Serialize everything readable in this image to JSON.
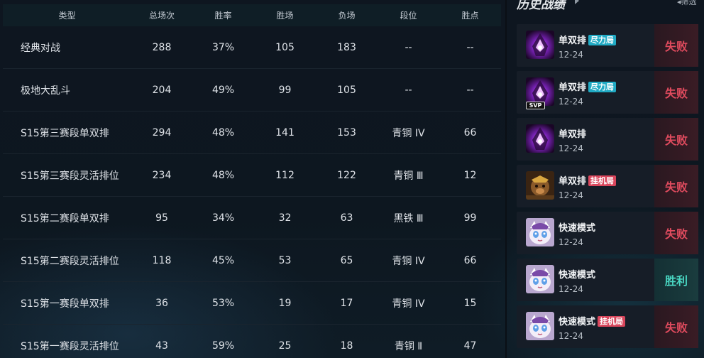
{
  "table": {
    "headers": [
      "类型",
      "总场次",
      "胜率",
      "胜场",
      "负场",
      "段位",
      "胜点"
    ],
    "rows": [
      [
        "经典对战",
        "288",
        "37%",
        "105",
        "183",
        "--",
        "--"
      ],
      [
        "极地大乱斗",
        "204",
        "49%",
        "99",
        "105",
        "--",
        "--"
      ],
      [
        "S15第三赛段单双排",
        "294",
        "48%",
        "141",
        "153",
        "青铜 IV",
        "66"
      ],
      [
        "S15第三赛段灵活排位",
        "234",
        "48%",
        "112",
        "122",
        "青铜 Ⅲ",
        "12"
      ],
      [
        "S15第二赛段单双排",
        "95",
        "34%",
        "32",
        "63",
        "黑铁 Ⅲ",
        "99"
      ],
      [
        "S15第二赛段灵活排位",
        "118",
        "45%",
        "53",
        "65",
        "青铜 IV",
        "66"
      ],
      [
        "S15第一赛段单双排",
        "36",
        "53%",
        "19",
        "17",
        "青铜 IV",
        "15"
      ],
      [
        "S15第一赛段灵活排位",
        "43",
        "59%",
        "25",
        "18",
        "青铜 Ⅱ",
        "47"
      ]
    ]
  },
  "history": {
    "title": "历史战绩",
    "filter_label": "筛选",
    "matches": [
      {
        "mode": "单双排",
        "tag": "尽力局",
        "tag_color": "cyan",
        "date": "12-24",
        "result": "失败",
        "outcome": "lose",
        "champion_icon": "void-champion",
        "svp": ""
      },
      {
        "mode": "单双排",
        "tag": "尽力局",
        "tag_color": "cyan",
        "date": "12-24",
        "result": "失败",
        "outcome": "lose",
        "champion_icon": "void-champion",
        "svp": "SVP"
      },
      {
        "mode": "单双排",
        "tag": "",
        "tag_color": "",
        "date": "12-24",
        "result": "失败",
        "outcome": "lose",
        "champion_icon": "void-champion",
        "svp": ""
      },
      {
        "mode": "单双排",
        "tag": "挂机局",
        "tag_color": "red",
        "date": "12-24",
        "result": "失败",
        "outcome": "lose",
        "champion_icon": "monkey-champion",
        "svp": ""
      },
      {
        "mode": "快速模式",
        "tag": "",
        "tag_color": "",
        "date": "12-24",
        "result": "失败",
        "outcome": "lose",
        "champion_icon": "cat-champion",
        "svp": ""
      },
      {
        "mode": "快速模式",
        "tag": "",
        "tag_color": "",
        "date": "12-24",
        "result": "胜利",
        "outcome": "win",
        "champion_icon": "cat-champion",
        "svp": ""
      },
      {
        "mode": "快速模式",
        "tag": "挂机局",
        "tag_color": "red",
        "date": "12-24",
        "result": "失败",
        "outcome": "lose",
        "champion_icon": "cat-champion",
        "svp": ""
      }
    ]
  },
  "colors": {
    "lose": "#e04b5e",
    "win": "#49d6c2",
    "tag_cyan": "#20aac4",
    "tag_red": "#d9465c"
  }
}
